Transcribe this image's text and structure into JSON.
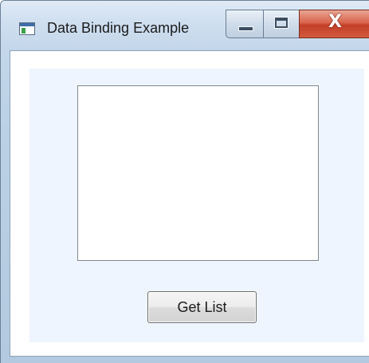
{
  "window": {
    "title": "Data Binding Example",
    "close_glyph": "X"
  },
  "controls": {
    "get_list_label": "Get List"
  },
  "icons": {
    "app": "window-app-icon",
    "minimize": "minimize-icon",
    "maximize": "maximize-icon",
    "close": "close-icon"
  },
  "colors": {
    "client_panel": "#eef5fe",
    "close_button": "#d9644c",
    "titlebar": "#cfdff0"
  }
}
